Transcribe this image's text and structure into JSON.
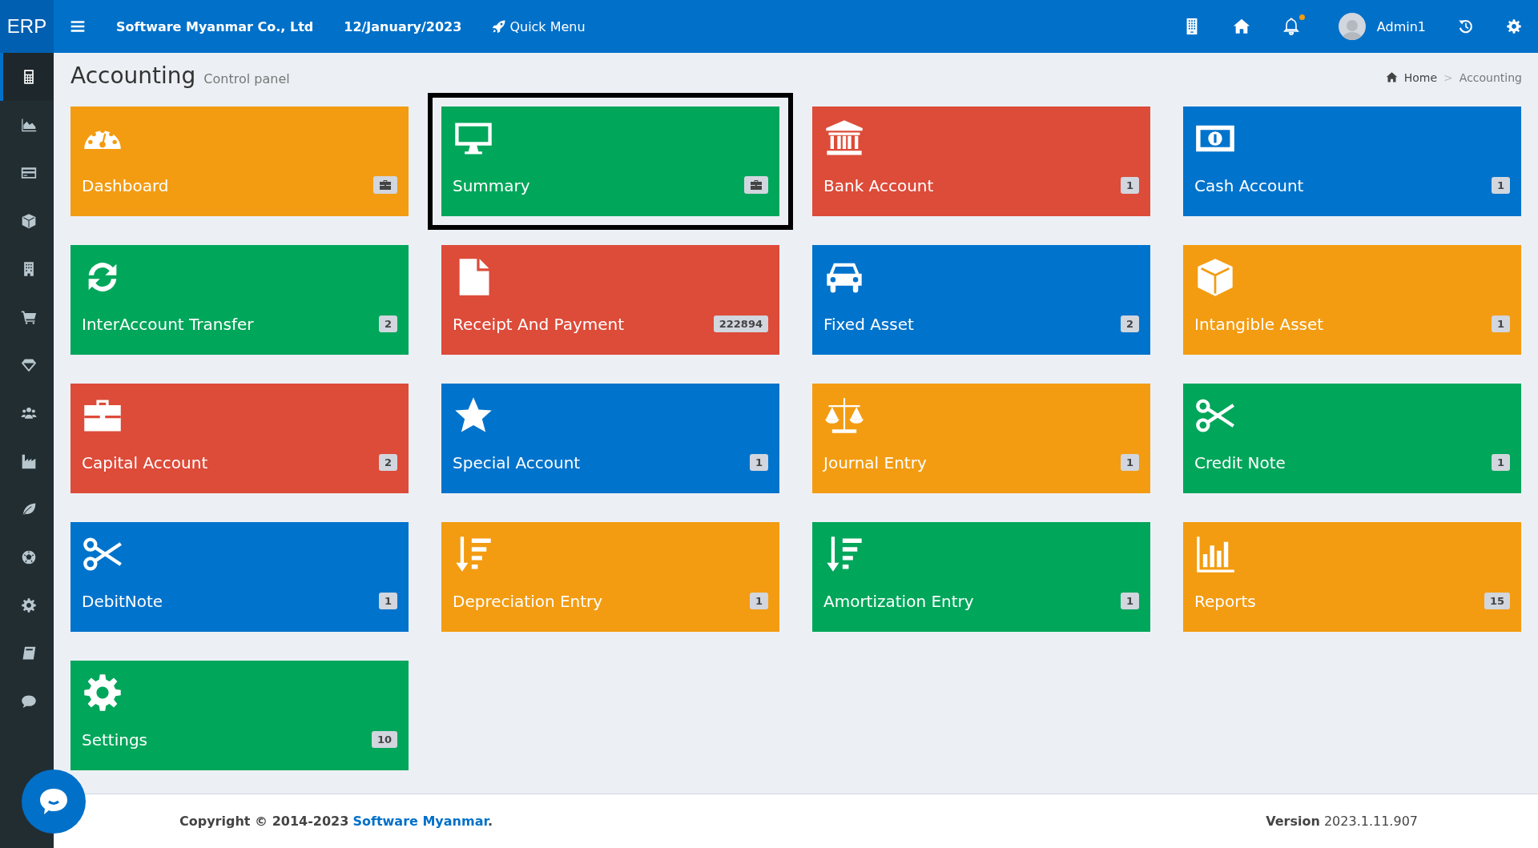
{
  "header": {
    "logo": "ERP",
    "company": "Software Myanmar Co., Ltd",
    "date": "12/January/2023",
    "quick_menu": "Quick Menu",
    "user": "Admin1",
    "notification": true
  },
  "sidebar": {
    "items": [
      {
        "kind": "calculator",
        "selected": true
      },
      {
        "kind": "area-chart",
        "selected": false
      },
      {
        "kind": "card",
        "selected": false
      },
      {
        "kind": "cube",
        "selected": false
      },
      {
        "kind": "building",
        "selected": false
      },
      {
        "kind": "cart",
        "selected": false
      },
      {
        "kind": "diamond",
        "selected": false
      },
      {
        "kind": "users",
        "selected": false
      },
      {
        "kind": "factory",
        "selected": false
      },
      {
        "kind": "leaf",
        "selected": false
      },
      {
        "kind": "ball",
        "selected": false
      },
      {
        "kind": "gear",
        "selected": false
      },
      {
        "kind": "book",
        "selected": false
      },
      {
        "kind": "chat",
        "selected": false
      }
    ]
  },
  "page": {
    "title": "Accounting",
    "subtitle": "Control panel",
    "breadcrumb": [
      "Home",
      "Accounting"
    ],
    "breadcrumb_separator": ">"
  },
  "tiles": [
    {
      "label": "Dashboard",
      "color": "#f39c12",
      "kind": "gauge",
      "badge": {
        "kind": "icon"
      },
      "selected": false
    },
    {
      "label": "Summary",
      "color": "#00a65a",
      "kind": "monitor",
      "badge": {
        "kind": "icon"
      },
      "selected": true
    },
    {
      "label": "Bank Account",
      "color": "#dd4b39",
      "kind": "bank",
      "badge": {
        "kind": "count",
        "text": "1"
      },
      "selected": false
    },
    {
      "label": "Cash Account",
      "color": "#0073cc",
      "kind": "money",
      "badge": {
        "kind": "count",
        "text": "1"
      },
      "selected": false
    },
    {
      "label": "InterAccount Transfer",
      "color": "#00a65a",
      "kind": "sync",
      "badge": {
        "kind": "count",
        "text": "2"
      },
      "selected": false
    },
    {
      "label": "Receipt And Payment",
      "color": "#dd4b39",
      "kind": "file",
      "badge": {
        "kind": "count",
        "text": "222894"
      },
      "selected": false
    },
    {
      "label": "Fixed Asset",
      "color": "#0073cc",
      "kind": "car",
      "badge": {
        "kind": "count",
        "text": "2"
      },
      "selected": false
    },
    {
      "label": "Intangible Asset",
      "color": "#f39c12",
      "kind": "cube",
      "badge": {
        "kind": "count",
        "text": "1"
      },
      "selected": false
    },
    {
      "label": "Capital Account",
      "color": "#dd4b39",
      "kind": "briefcase",
      "badge": {
        "kind": "count",
        "text": "2"
      },
      "selected": false
    },
    {
      "label": "Special Account",
      "color": "#0073cc",
      "kind": "star",
      "badge": {
        "kind": "count",
        "text": "1"
      },
      "selected": false
    },
    {
      "label": "Journal Entry",
      "color": "#f39c12",
      "kind": "scale",
      "badge": {
        "kind": "count",
        "text": "1"
      },
      "selected": false
    },
    {
      "label": "Credit Note",
      "color": "#00a65a",
      "kind": "scissors",
      "badge": {
        "kind": "count",
        "text": "1"
      },
      "selected": false
    },
    {
      "label": "DebitNote",
      "color": "#0073cc",
      "kind": "scissors",
      "badge": {
        "kind": "count",
        "text": "1"
      },
      "selected": false
    },
    {
      "label": "Depreciation Entry",
      "color": "#f39c12",
      "kind": "sort",
      "badge": {
        "kind": "count",
        "text": "1"
      },
      "selected": false
    },
    {
      "label": "Amortization Entry",
      "color": "#00a65a",
      "kind": "sort",
      "badge": {
        "kind": "count",
        "text": "1"
      },
      "selected": false
    },
    {
      "label": "Reports",
      "color": "#f39c12",
      "kind": "bars",
      "badge": {
        "kind": "count",
        "text": "15"
      },
      "selected": false
    },
    {
      "label": "Settings",
      "color": "#00a65a",
      "kind": "gear",
      "badge": {
        "kind": "count",
        "text": "10"
      },
      "selected": false
    }
  ],
  "footer": {
    "copyright": "Copyright © 2014-2023",
    "company_link": "Software Myanmar",
    "period": ".",
    "version_label": "Version",
    "version": "2023.1.11.907"
  }
}
